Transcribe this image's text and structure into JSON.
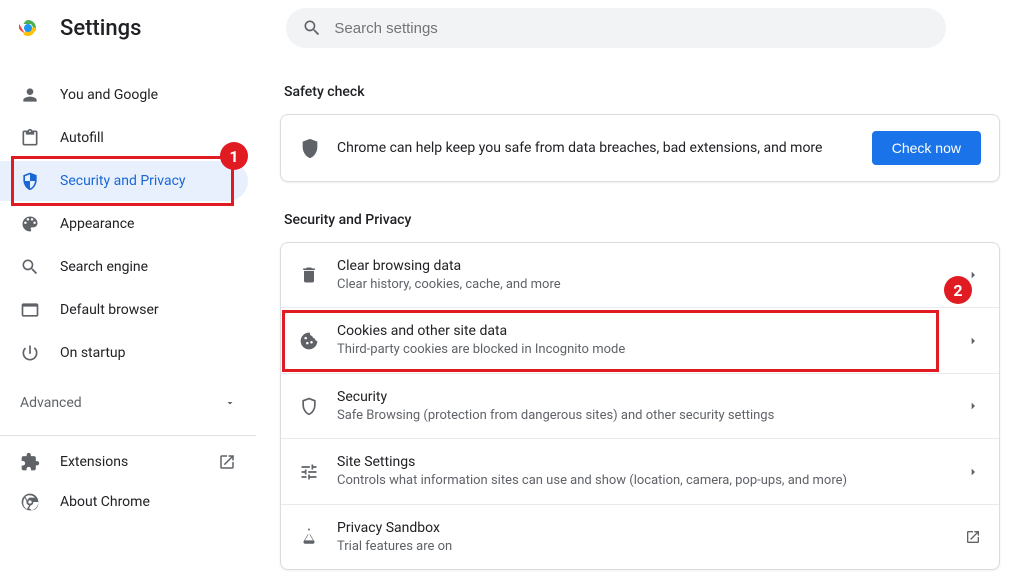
{
  "header": {
    "title": "Settings",
    "search_placeholder": "Search settings"
  },
  "sidebar": {
    "items": [
      {
        "label": "You and Google"
      },
      {
        "label": "Autofill"
      },
      {
        "label": "Security and Privacy"
      },
      {
        "label": "Appearance"
      },
      {
        "label": "Search engine"
      },
      {
        "label": "Default browser"
      },
      {
        "label": "On startup"
      }
    ],
    "advanced_label": "Advanced",
    "extensions_label": "Extensions",
    "about_label": "About Chrome"
  },
  "safety": {
    "section": "Safety check",
    "text": "Chrome can help keep you safe from data breaches, bad extensions, and more",
    "button": "Check now"
  },
  "privacy": {
    "section": "Security and Privacy",
    "rows": [
      {
        "title": "Clear browsing data",
        "sub": "Clear history, cookies, cache, and more"
      },
      {
        "title": "Cookies and other site data",
        "sub": "Third-party cookies are blocked in Incognito mode"
      },
      {
        "title": "Security",
        "sub": "Safe Browsing (protection from dangerous sites) and other security settings"
      },
      {
        "title": "Site Settings",
        "sub": "Controls what information sites can use and show (location, camera, pop-ups, and more)"
      },
      {
        "title": "Privacy Sandbox",
        "sub": "Trial features are on"
      }
    ]
  },
  "annotations": {
    "badge1": "1",
    "badge2": "2"
  }
}
